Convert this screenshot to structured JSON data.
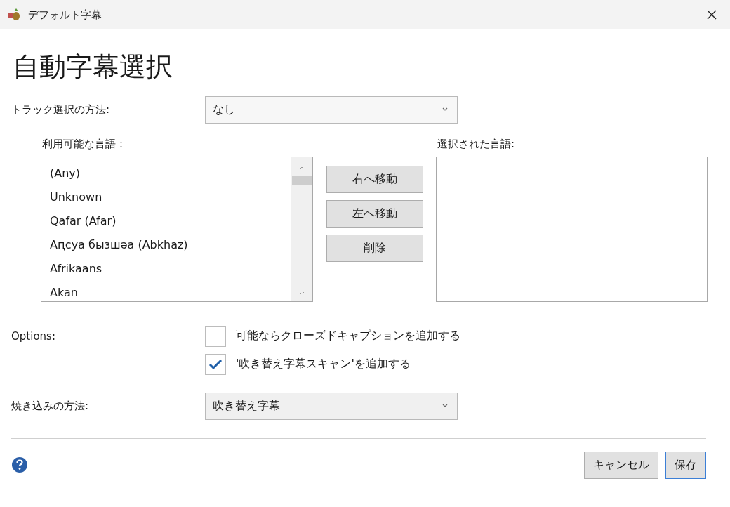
{
  "window": {
    "title": "デフォルト字幕"
  },
  "heading": "自動字幕選択",
  "track_selection": {
    "label": "トラック選択の方法:",
    "value": "なし"
  },
  "available_languages": {
    "label": "利用可能な言語：",
    "items": [
      "(Any)",
      "Unknown",
      "Qafar (Afar)",
      "Aԥсуа бызшәа (Abkhaz)",
      "Afrikaans",
      "Akan"
    ]
  },
  "move_buttons": [
    "右へ移動",
    "左へ移動",
    "削除"
  ],
  "selected_languages": {
    "label": "選択された言語:"
  },
  "options": {
    "label": "Options:",
    "checkboxes": [
      {
        "label": "可能ならクローズドキャプションを追加する",
        "checked": false
      },
      {
        "label": "'吹き替え字幕スキャン'を追加する",
        "checked": true
      }
    ]
  },
  "burn_in": {
    "label": "焼き込みの方法:",
    "value": "吹き替え字幕"
  },
  "footer_buttons": [
    {
      "label": "キャンセル",
      "default": false
    },
    {
      "label": "保存",
      "default": true
    }
  ]
}
